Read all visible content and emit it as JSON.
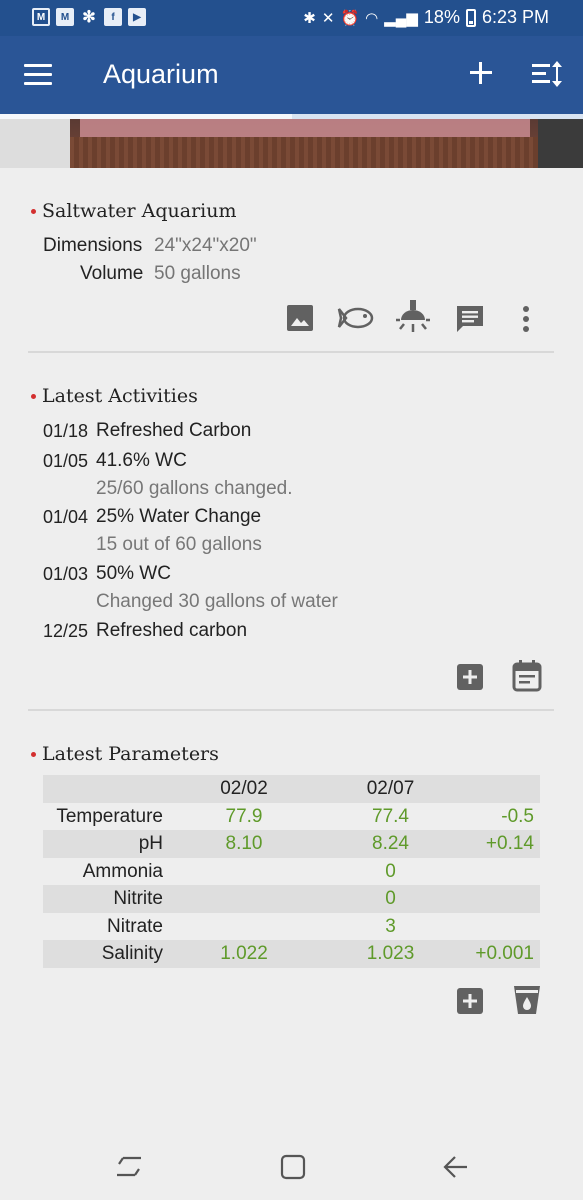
{
  "status_bar": {
    "battery": "18%",
    "time": "6:23 PM"
  },
  "toolbar": {
    "title": "Aquarium"
  },
  "progress_fraction": 0.5,
  "tank": {
    "name": "Saltwater Aquarium",
    "dimensions_label": "Dimensions",
    "dimensions_value": "24\"x24\"x20\"",
    "volume_label": "Volume",
    "volume_value": "50 gallons"
  },
  "activities": {
    "title": "Latest Activities",
    "items": [
      {
        "date": "01/18",
        "text": "Refreshed Carbon",
        "sub": ""
      },
      {
        "date": "01/05",
        "text": "41.6% WC",
        "sub": "25/60 gallons changed."
      },
      {
        "date": "01/04",
        "text": "25% Water Change",
        "sub": "15 out of 60 gallons"
      },
      {
        "date": "01/03",
        "text": "50% WC",
        "sub": "Changed 30 gallons of water"
      },
      {
        "date": "12/25",
        "text": "Refreshed carbon",
        "sub": ""
      }
    ]
  },
  "parameters": {
    "title": "Latest Parameters",
    "columns": [
      "02/02",
      "02/07"
    ],
    "rows": [
      {
        "name": "Temperature",
        "v1": "77.9",
        "v2": "77.4",
        "delta": "-0.5"
      },
      {
        "name": "pH",
        "v1": "8.10",
        "v2": "8.24",
        "delta": "+0.14"
      },
      {
        "name": "Ammonia",
        "v1": "",
        "v2": "0",
        "delta": ""
      },
      {
        "name": "Nitrite",
        "v1": "",
        "v2": "0",
        "delta": ""
      },
      {
        "name": "Nitrate",
        "v1": "",
        "v2": "3",
        "delta": ""
      },
      {
        "name": "Salinity",
        "v1": "1.022",
        "v2": "1.023",
        "delta": "+0.001"
      }
    ]
  },
  "colors": {
    "appbar": "#2a5596",
    "accent_value": "#5f9a2a",
    "bullet": "#d32f2f"
  },
  "icons": [
    "menu-icon",
    "add-icon",
    "sort-icon",
    "image-icon",
    "fish-icon",
    "light-icon",
    "comment-icon",
    "more-vert-icon",
    "add-box-icon",
    "calendar-icon",
    "test-cup-icon"
  ]
}
